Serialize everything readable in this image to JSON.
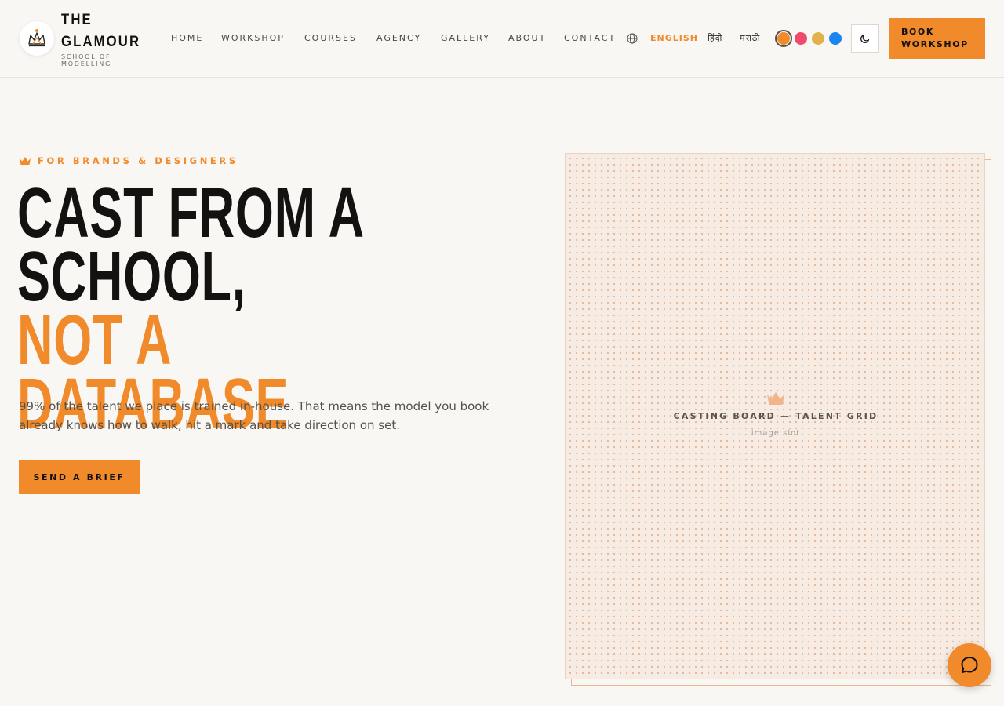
{
  "brand": {
    "name_line1": "THE",
    "name_line2": "GLAMOUR",
    "tagline": "SCHOOL OF MODELLING"
  },
  "nav": {
    "items": [
      {
        "label": "HOME"
      },
      {
        "label": "WORKSHOP"
      },
      {
        "label": "COURSES"
      },
      {
        "label": "AGENCY"
      },
      {
        "label": "GALLERY"
      },
      {
        "label": "ABOUT"
      },
      {
        "label": "CONTACT"
      }
    ]
  },
  "language": {
    "icon": "globe-icon",
    "options": [
      {
        "label": "ENGLISH",
        "active": true
      },
      {
        "label": "हिंदी",
        "active": false
      },
      {
        "label": "मराठी",
        "active": false
      }
    ]
  },
  "theme": {
    "swatches": [
      {
        "color": "#f08a2a",
        "selected": true
      },
      {
        "color": "#ef4b6c",
        "selected": false
      },
      {
        "color": "#e3b04b",
        "selected": false
      },
      {
        "color": "#1a84f0",
        "selected": false
      }
    ],
    "mode_icon": "moon-icon"
  },
  "header": {
    "cta_label": "BOOK WORKSHOP"
  },
  "hero": {
    "eyebrow": "FOR BRANDS & DESIGNERS",
    "headline_line1": "CAST FROM A",
    "headline_line2": "SCHOOL,",
    "headline_line3": "NOT A DATABASE",
    "lead": "99% of the talent we place is trained in-house. That means the model you book already knows how to walk, hit a mark and take direction on set.",
    "cta_label": "SEND A BRIEF"
  },
  "image_slot": {
    "title": "CASTING BOARD — TALENT GRID",
    "subtitle": "image slot"
  },
  "chat": {
    "icon": "chat-bubble-icon"
  },
  "colors": {
    "accent": "#f08a2a",
    "background": "#f9f7f4",
    "text": "#141210"
  }
}
